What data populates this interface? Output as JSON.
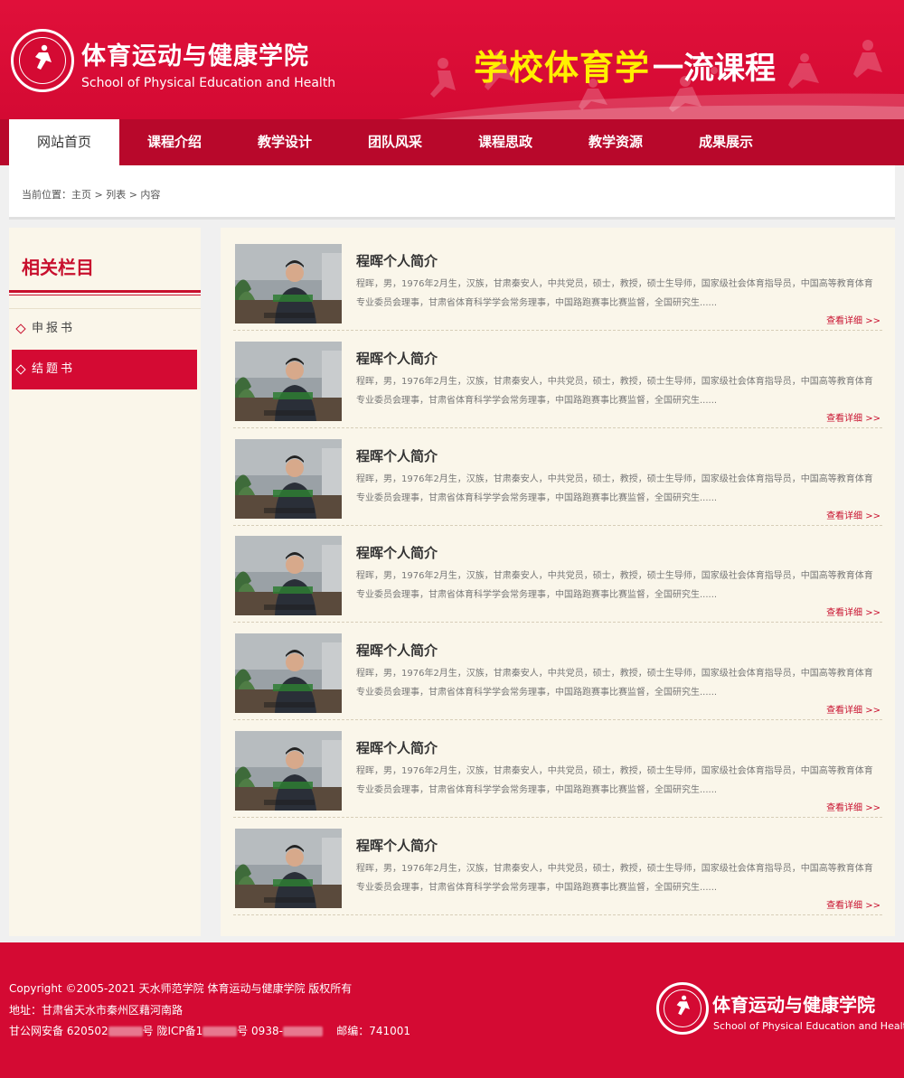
{
  "colors": {
    "brand_red": "#d40a33",
    "nav_red": "#b8082b",
    "slogan_yellow": "#ffef00",
    "panel_bg": "#faf6ea"
  },
  "header": {
    "logo_cn": "体育运动与健康学院",
    "logo_en": "School of Physical Education and Health",
    "slogan_highlight": "学校体育学",
    "slogan_rest": "一流课程"
  },
  "nav": {
    "items": [
      {
        "label": "网站首页",
        "active": true
      },
      {
        "label": "课程介绍"
      },
      {
        "label": "教学设计"
      },
      {
        "label": "团队风采"
      },
      {
        "label": "课程思政"
      },
      {
        "label": "教学资源"
      },
      {
        "label": "成果展示"
      }
    ]
  },
  "breadcrumb": {
    "text": "当前位置：主页 > 列表 > 内容"
  },
  "sidebar": {
    "title": "相关栏目",
    "items": [
      {
        "label": "申报书",
        "icon": "diamond-icon"
      },
      {
        "label": "结题书",
        "icon": "diamond-icon",
        "active": true
      }
    ]
  },
  "list": {
    "items": [
      {
        "title": "程晖个人简介",
        "desc": "程晖，男，1976年2月生，汉族，甘肃秦安人，中共党员，硕士，教授，硕士生导师，国家级社会体育指导员，中国高等教育体育专业委员会理事，甘肃省体育科学学会常务理事，中国路跑赛事比赛监督，全国研究生......",
        "more": "查看详细 >>"
      },
      {
        "title": "程晖个人简介",
        "desc": "程晖，男，1976年2月生，汉族，甘肃秦安人，中共党员，硕士，教授，硕士生导师，国家级社会体育指导员，中国高等教育体育专业委员会理事，甘肃省体育科学学会常务理事，中国路跑赛事比赛监督，全国研究生......",
        "more": "查看详细 >>"
      },
      {
        "title": "程晖个人简介",
        "desc": "程晖，男，1976年2月生，汉族，甘肃秦安人，中共党员，硕士，教授，硕士生导师，国家级社会体育指导员，中国高等教育体育专业委员会理事，甘肃省体育科学学会常务理事，中国路跑赛事比赛监督，全国研究生......",
        "more": "查看详细 >>"
      },
      {
        "title": "程晖个人简介",
        "desc": "程晖，男，1976年2月生，汉族，甘肃秦安人，中共党员，硕士，教授，硕士生导师，国家级社会体育指导员，中国高等教育体育专业委员会理事，甘肃省体育科学学会常务理事，中国路跑赛事比赛监督，全国研究生......",
        "more": "查看详细 >>"
      },
      {
        "title": "程晖个人简介",
        "desc": "程晖，男，1976年2月生，汉族，甘肃秦安人，中共党员，硕士，教授，硕士生导师，国家级社会体育指导员，中国高等教育体育专业委员会理事，甘肃省体育科学学会常务理事，中国路跑赛事比赛监督，全国研究生......",
        "more": "查看详细 >>"
      },
      {
        "title": "程晖个人简介",
        "desc": "程晖，男，1976年2月生，汉族，甘肃秦安人，中共党员，硕士，教授，硕士生导师，国家级社会体育指导员，中国高等教育体育专业委员会理事，甘肃省体育科学学会常务理事，中国路跑赛事比赛监督，全国研究生......",
        "more": "查看详细 >>"
      },
      {
        "title": "程晖个人简介",
        "desc": "程晖，男，1976年2月生，汉族，甘肃秦安人，中共党员，硕士，教授，硕士生导师，国家级社会体育指导员，中国高等教育体育专业委员会理事，甘肃省体育科学学会常务理事，中国路跑赛事比赛监督，全国研究生......",
        "more": "查看详细 >>"
      }
    ]
  },
  "footer": {
    "copyright": "Copyright ©2005-2021   天水师范学院 体育运动与健康学院 版权所有",
    "address": "地址：甘肃省天水市秦州区藉河南路",
    "beian_prefix": "甘公网安备 620502",
    "beian_mid": "号 陇ICP备1",
    "beian_suffix": "号   0938-",
    "postcode": "邮编：741001",
    "logo_cn": "体育运动与健康学院",
    "logo_en": "School of Physical Education and Health"
  }
}
